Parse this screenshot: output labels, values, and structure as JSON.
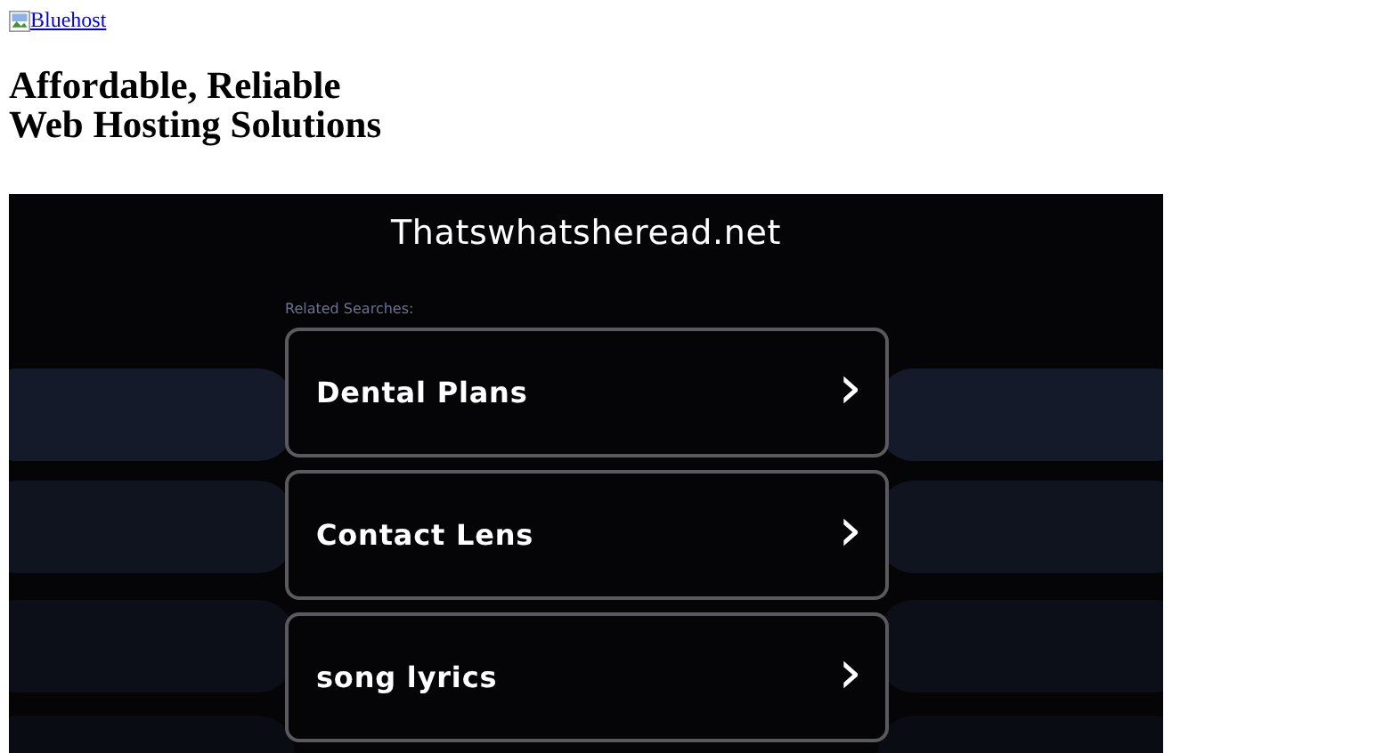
{
  "logo_link": {
    "text": "Bluehost"
  },
  "heading": {
    "lines": [
      "Affordable, Reliable",
      "Web Hosting Solutions"
    ]
  },
  "parked_page": {
    "domain": "Thatswhatsheread.net",
    "related_label": "Related Searches:",
    "results": [
      {
        "label": "Dental Plans",
        "icon": "›"
      },
      {
        "label": "Contact Lens",
        "icon": "›"
      },
      {
        "label": "song lyrics",
        "icon": "›"
      }
    ]
  }
}
